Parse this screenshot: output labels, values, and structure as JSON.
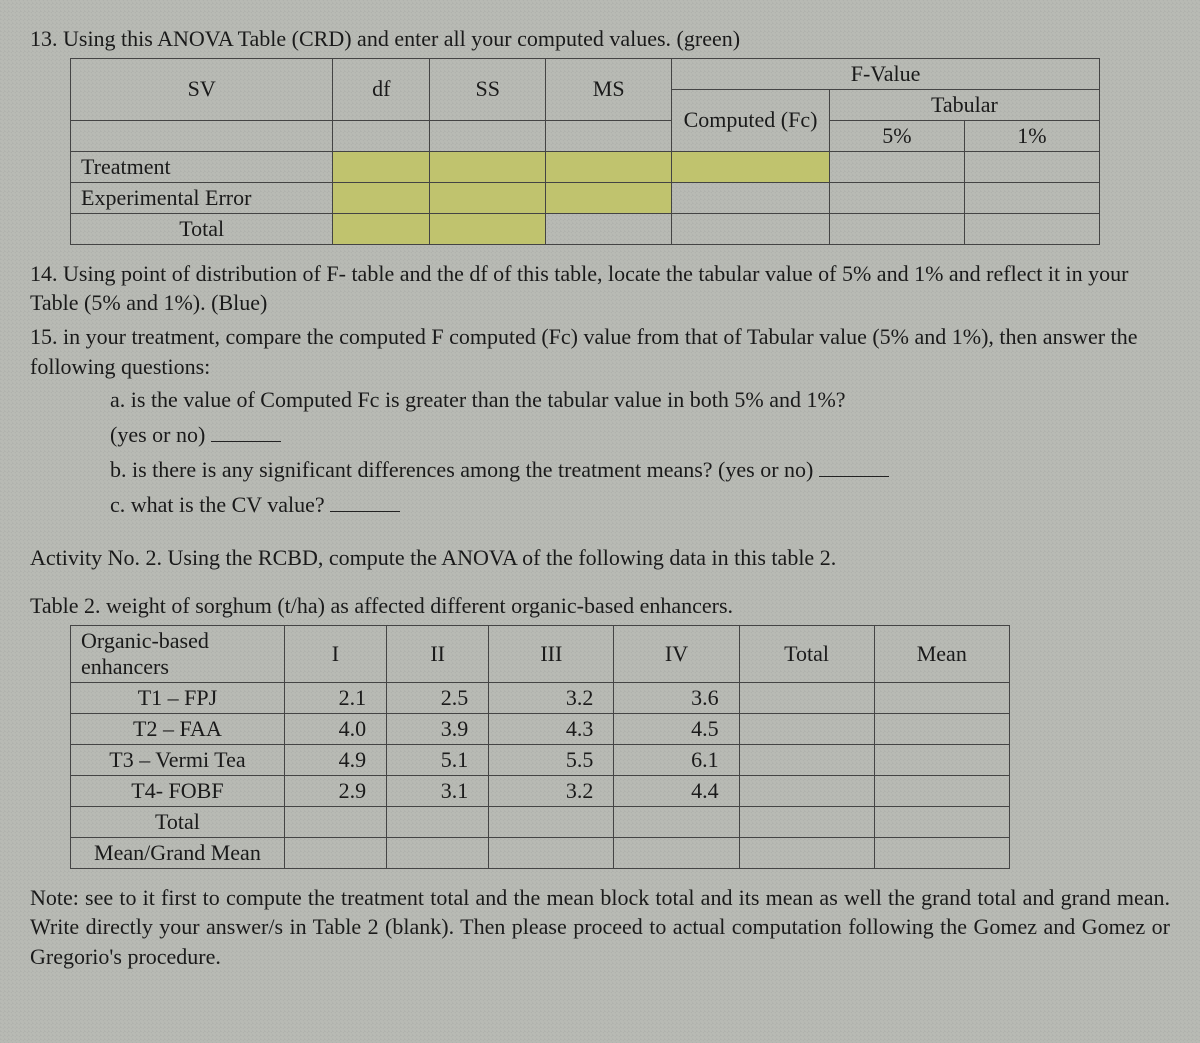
{
  "q13": {
    "prompt": "13. Using this ANOVA Table (CRD) and enter all your computed values. (green)",
    "headers": {
      "sv": "SV",
      "df": "df",
      "ss": "SS",
      "ms": "MS",
      "fvalue": "F-Value",
      "computed": "Computed (Fc)",
      "tabular": "Tabular",
      "p5": "5%",
      "p1": "1%"
    },
    "rows": {
      "treatment": "Treatment",
      "error": "Experimental Error",
      "total": "Total"
    }
  },
  "q14": "14. Using point of distribution of F- table and the df of this table, locate the tabular value of 5% and 1% and reflect it in your Table (5% and 1%). (Blue)",
  "q15": {
    "lead": "15. in your treatment, compare the computed F computed (Fc) value from that of Tabular value (5% and 1%), then answer the following questions:",
    "a": "a. is the value of Computed Fc is greater than the tabular value in both 5% and 1%?",
    "a2": "(yes or no)",
    "b": "b. is there is any significant differences among the treatment means? (yes or no)",
    "c": "c. what is the CV value?"
  },
  "activity": "Activity No. 2. Using the RCBD, compute the ANOVA of the following data in this table 2.",
  "table2": {
    "caption": "Table 2. weight of sorghum (t/ha) as affected different organic-based enhancers.",
    "headers": {
      "group": "Organic-based enhancers",
      "I": "I",
      "II": "II",
      "III": "III",
      "IV": "IV",
      "total": "Total",
      "mean": "Mean"
    },
    "rows": {
      "t1": {
        "label": "T1 – FPJ",
        "I": "2.1",
        "II": "2.5",
        "III": "3.2",
        "IV": "3.6"
      },
      "t2": {
        "label": "T2 – FAA",
        "I": "4.0",
        "II": "3.9",
        "III": "4.3",
        "IV": "4.5"
      },
      "t3": {
        "label": "T3 – Vermi Tea",
        "I": "4.9",
        "II": "5.1",
        "III": "5.5",
        "IV": "6.1"
      },
      "t4": {
        "label": "T4- FOBF",
        "I": "2.9",
        "II": "3.1",
        "III": "3.2",
        "IV": "4.4"
      },
      "total": "Total",
      "grand": "Mean/Grand Mean"
    }
  },
  "note": "Note: see to it first to compute the treatment total and the mean block total and its mean as well the grand total and grand mean. Write directly your answer/s in Table 2 (blank). Then please proceed to actual computation following the Gomez and Gomez or Gregorio's procedure."
}
